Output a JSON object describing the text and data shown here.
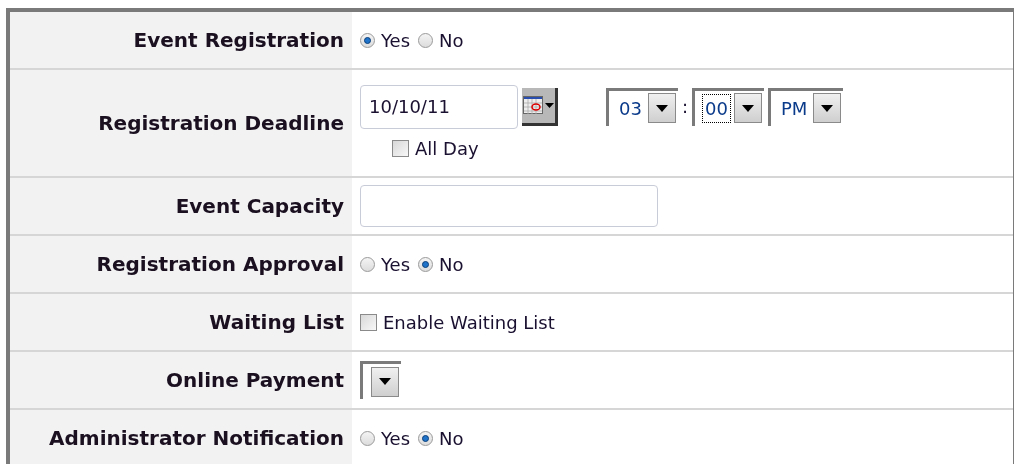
{
  "rows": [
    {
      "kind": "radio",
      "label": "Event Registration",
      "options": [
        {
          "label": "Yes",
          "selected": true
        },
        {
          "label": "No",
          "selected": false
        }
      ]
    },
    {
      "kind": "datetime",
      "label": "Registration Deadline",
      "date": "10/10/11",
      "hour": "03",
      "separator": ":",
      "minute": "00",
      "minute_focused": true,
      "period": "PM",
      "all_day": {
        "label": "All Day",
        "checked": false
      }
    },
    {
      "kind": "text",
      "label": "Event Capacity"
    },
    {
      "kind": "radio",
      "label": "Registration Approval",
      "options": [
        {
          "label": "Yes",
          "selected": false
        },
        {
          "label": "No",
          "selected": true
        }
      ]
    },
    {
      "kind": "checkbox",
      "label": "Waiting List",
      "option": {
        "label": "Enable Waiting List",
        "checked": false
      }
    },
    {
      "kind": "select",
      "label": "Online Payment"
    },
    {
      "kind": "radio",
      "label": "Administrator Notification",
      "options": [
        {
          "label": "Yes",
          "selected": false
        },
        {
          "label": "No",
          "selected": true
        }
      ]
    }
  ]
}
